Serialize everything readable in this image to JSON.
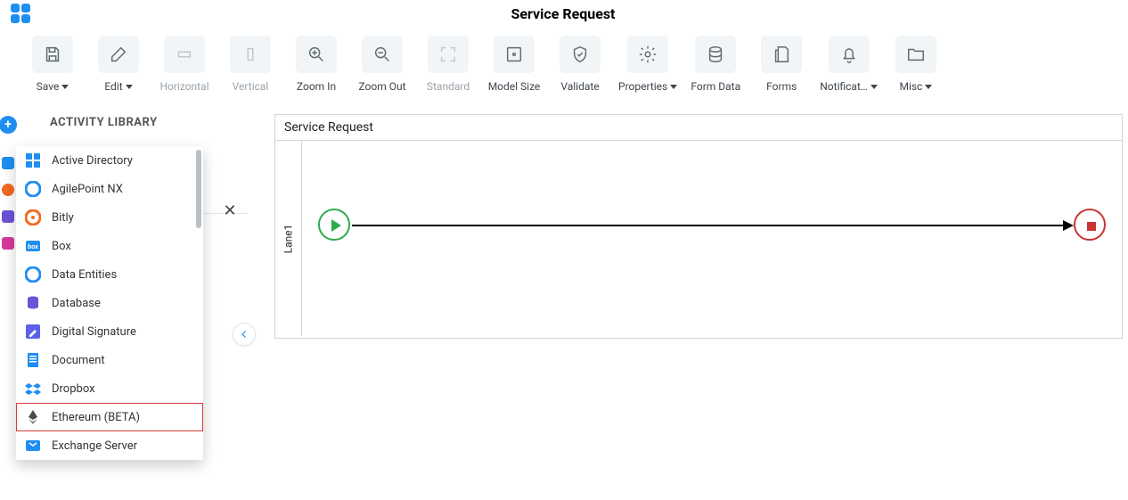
{
  "header": {
    "title": "Service Request"
  },
  "toolbar": {
    "save": "Save",
    "edit": "Edit",
    "horizontal": "Horizontal",
    "vertical": "Vertical",
    "zoom_in": "Zoom In",
    "zoom_out": "Zoom Out",
    "standard": "Standard",
    "model_size": "Model Size",
    "validate": "Validate",
    "properties": "Properties",
    "form_data": "Form Data",
    "forms": "Forms",
    "notifications": "Notificat…",
    "misc": "Misc"
  },
  "library": {
    "title": "ACTIVITY LIBRARY",
    "items": [
      {
        "label": "Active Directory",
        "icon": "windows",
        "color": "#1f8ef1"
      },
      {
        "label": "AgilePoint NX",
        "icon": "ap",
        "color": "#1f8ef1"
      },
      {
        "label": "Bitly",
        "icon": "bitly",
        "color": "#f26a21"
      },
      {
        "label": "Box",
        "icon": "box",
        "color": "#1f8ef1"
      },
      {
        "label": "Data Entities",
        "icon": "ap",
        "color": "#1f8ef1"
      },
      {
        "label": "Database",
        "icon": "cyl",
        "color": "#6b52d6"
      },
      {
        "label": "Digital Signature",
        "icon": "pen",
        "color": "#5b62ea"
      },
      {
        "label": "Document",
        "icon": "doc",
        "color": "#1f8ef1"
      },
      {
        "label": "Dropbox",
        "icon": "dropbox",
        "color": "#1f8ef1"
      },
      {
        "label": "Ethereum (BETA)",
        "icon": "eth",
        "color": "#4b4b4b",
        "highlight": true
      },
      {
        "label": "Exchange Server",
        "icon": "exch",
        "color": "#1f8ef1"
      }
    ]
  },
  "canvas": {
    "title": "Service Request",
    "lane": "Lane1"
  }
}
